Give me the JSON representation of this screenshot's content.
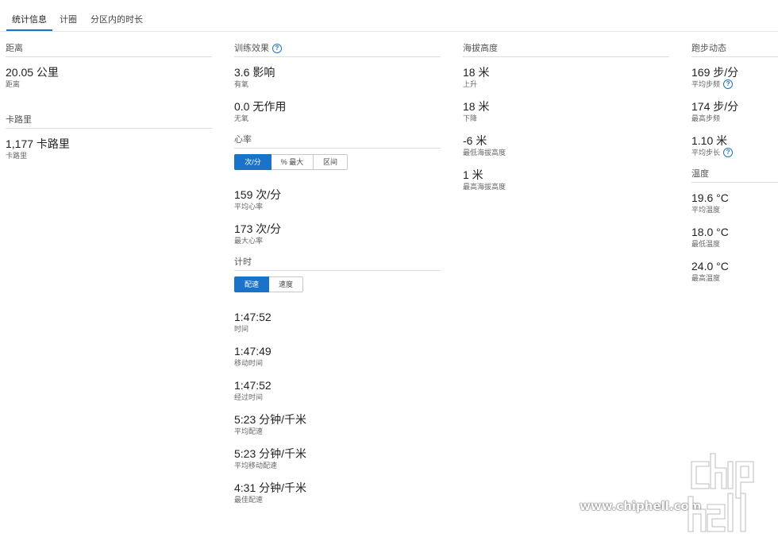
{
  "tabs": [
    "统计信息",
    "计圈",
    "分区内的时长"
  ],
  "distance": {
    "title": "距离",
    "value": "20.05 公里",
    "label": "距离"
  },
  "calories": {
    "title": "卡路里",
    "value": "1,177 卡路里",
    "label": "卡路里"
  },
  "training": {
    "title": "训练效果",
    "stats": [
      {
        "value": "3.6 影响",
        "label": "有氧"
      },
      {
        "value": "0.0 无作用",
        "label": "无氧"
      }
    ]
  },
  "heart_rate": {
    "title": "心率",
    "segments": [
      "次/分",
      "% 最大",
      "区间"
    ],
    "stats": [
      {
        "value": "159 次/分",
        "label": "平均心率"
      },
      {
        "value": "173 次/分",
        "label": "最大心率"
      }
    ]
  },
  "timing": {
    "title": "计时",
    "segments": [
      "配速",
      "速度"
    ],
    "stats": [
      {
        "value": "1:47:52",
        "label": "时间"
      },
      {
        "value": "1:47:49",
        "label": "移动时间"
      },
      {
        "value": "1:47:52",
        "label": "经过时间"
      },
      {
        "value": "5:23 分钟/千米",
        "label": "平均配速"
      },
      {
        "value": "5:23 分钟/千米",
        "label": "平均移动配速"
      },
      {
        "value": "4:31 分钟/千米",
        "label": "最佳配速"
      }
    ]
  },
  "elevation": {
    "title": "海拔高度",
    "stats": [
      {
        "value": "18 米",
        "label": "上升"
      },
      {
        "value": "18 米",
        "label": "下降"
      },
      {
        "value": "-6 米",
        "label": "最低海拔高度"
      },
      {
        "value": "1 米",
        "label": "最高海拔高度"
      }
    ]
  },
  "dynamics": {
    "title": "跑步动态",
    "stats": [
      {
        "value": "169 步/分",
        "label": "平均步频"
      },
      {
        "value": "174 步/分",
        "label": "最高步频"
      },
      {
        "value": "1.10 米",
        "label": "平均步长"
      }
    ]
  },
  "temperature": {
    "title": "温度",
    "stats": [
      {
        "value": "19.6 °C",
        "label": "平均温度"
      },
      {
        "value": "18.0 °C",
        "label": "最低温度"
      },
      {
        "value": "24.0 °C",
        "label": "最高温度"
      }
    ]
  },
  "watermark": {
    "url": "www.chiphell.com",
    "logo": "chip hell"
  },
  "colors": {
    "accent": "#1a73c9"
  }
}
